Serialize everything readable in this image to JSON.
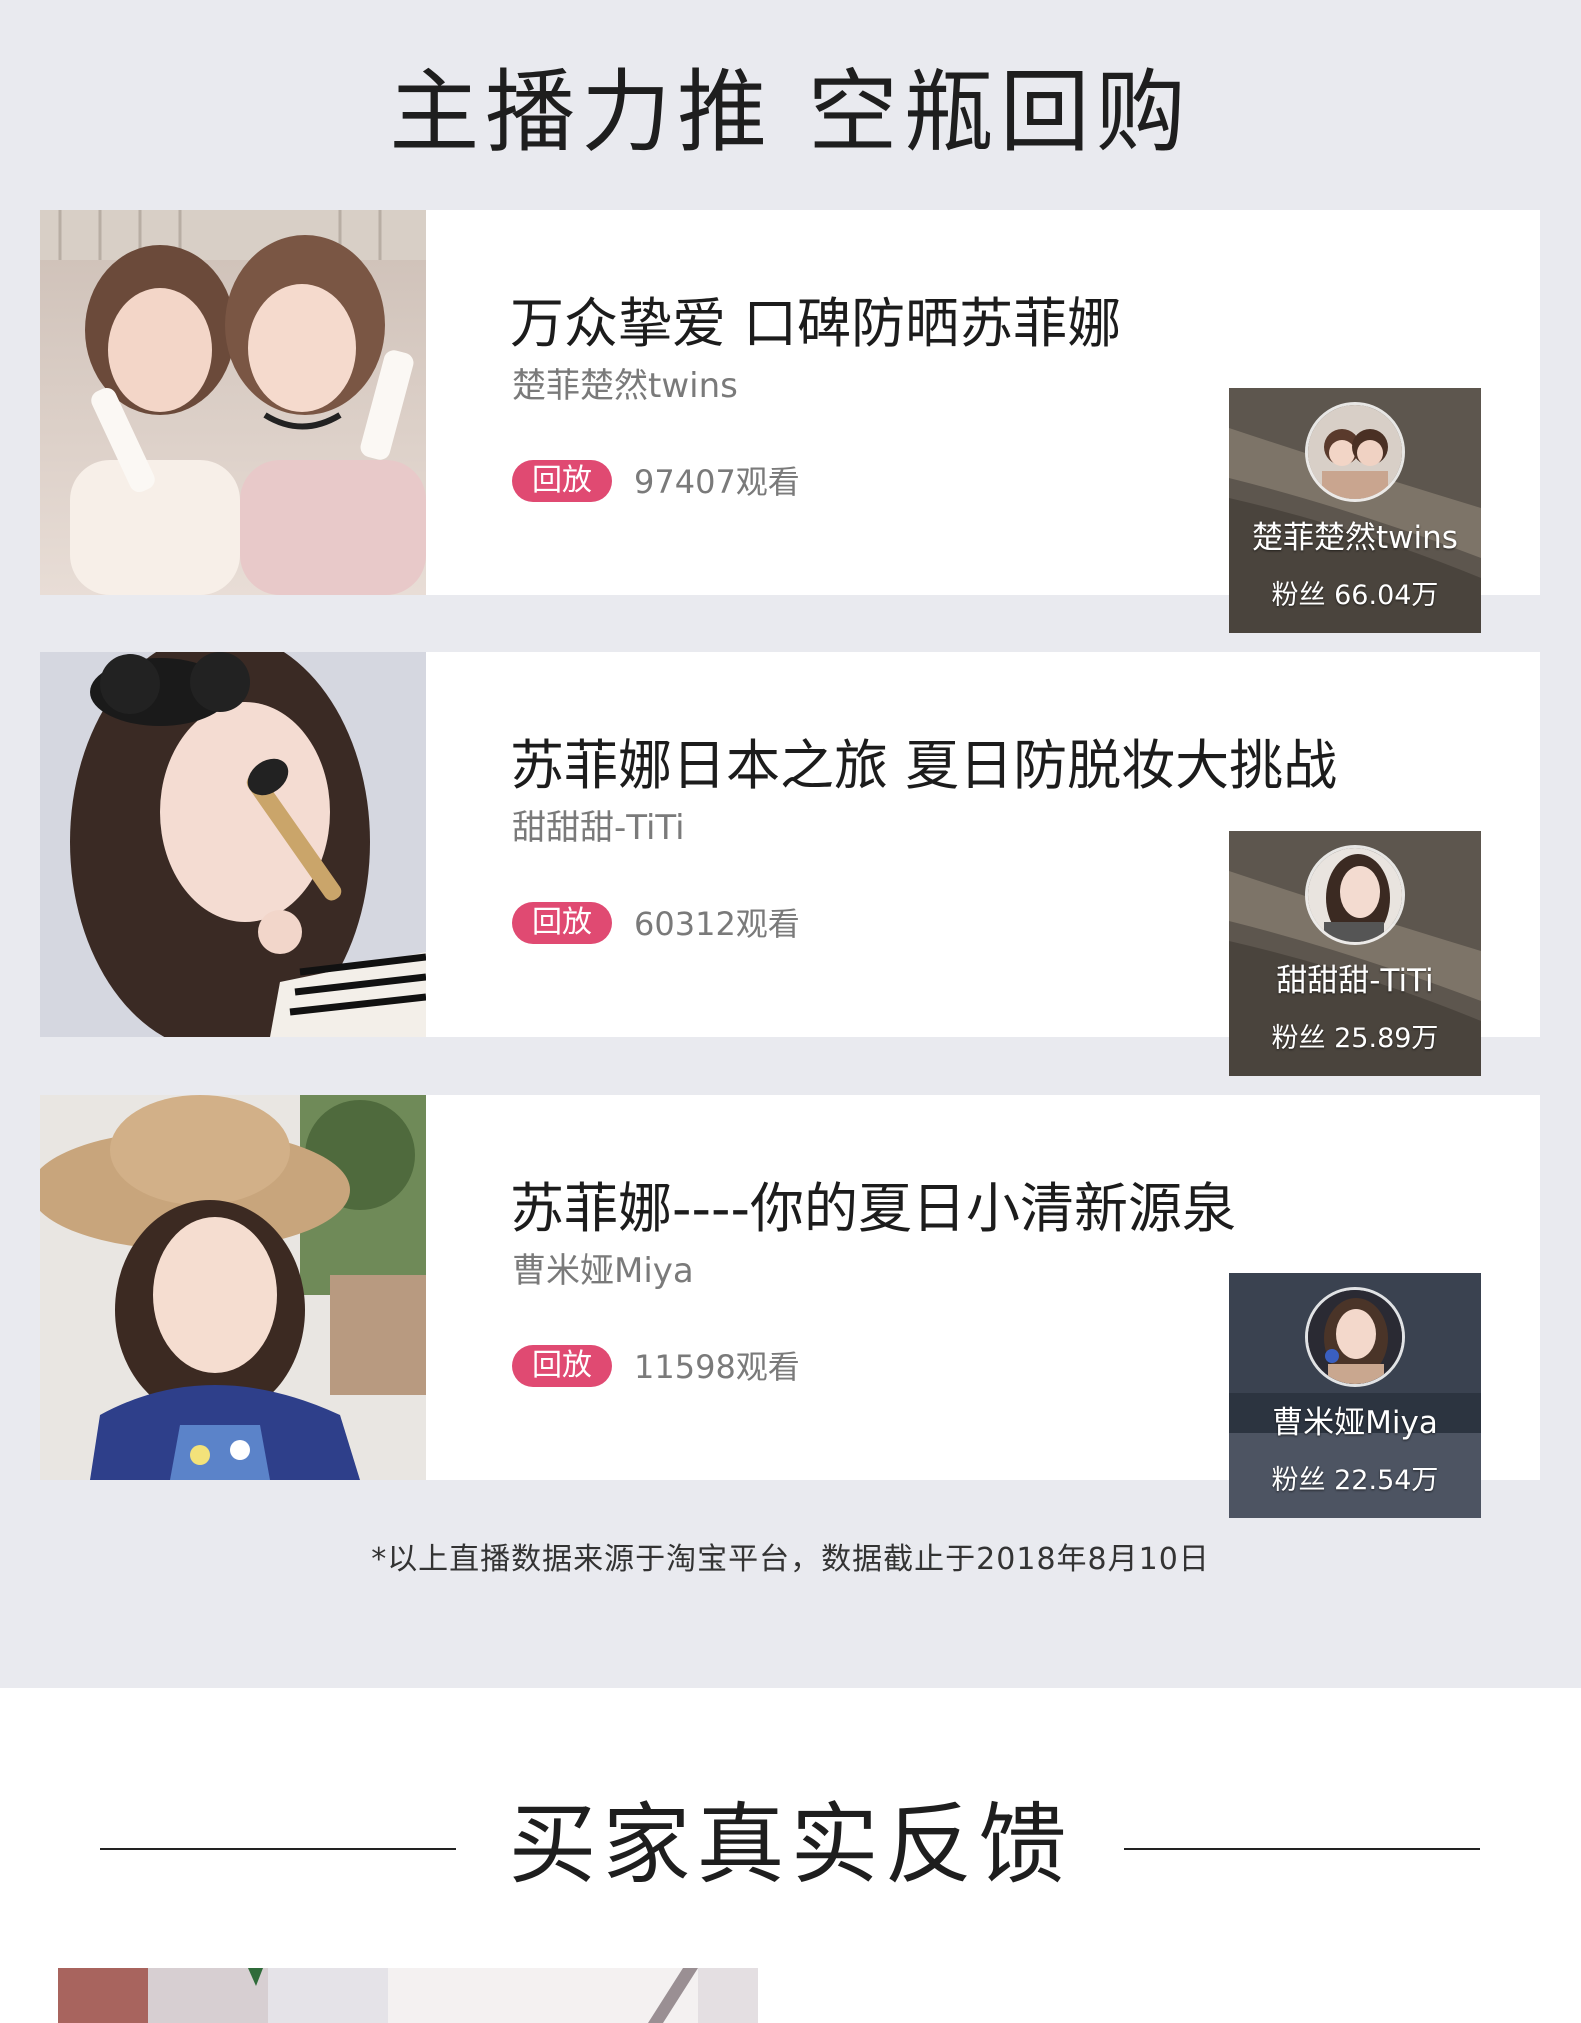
{
  "header": {
    "title": "主播力推 空瓶回购"
  },
  "cards": [
    {
      "title": "万众挚爱 口碑防晒苏菲娜",
      "author": "楚菲楚然twins",
      "replay_label": "回放",
      "views": "97407观看",
      "anchor_name": "楚菲楚然twins",
      "anchor_fans": "粉丝 66.04万"
    },
    {
      "title": "苏菲娜日本之旅 夏日防脱妆大挑战",
      "author": "甜甜甜-TiTi",
      "replay_label": "回放",
      "views": "60312观看",
      "anchor_name": "甜甜甜-TiTi",
      "anchor_fans": "粉丝 25.89万"
    },
    {
      "title": "苏菲娜----你的夏日小清新源泉",
      "author": "曹米娅Miya",
      "replay_label": "回放",
      "views": "11598观看",
      "anchor_name": "曹米娅Miya",
      "anchor_fans": "粉丝 22.54万"
    }
  ],
  "footnote": "*以上直播数据来源于淘宝平台，数据截止于2018年8月10日",
  "feedback": {
    "title": "买家真实反馈"
  },
  "colors": {
    "accent": "#e04a72",
    "section_bg": "#e9eaef"
  }
}
